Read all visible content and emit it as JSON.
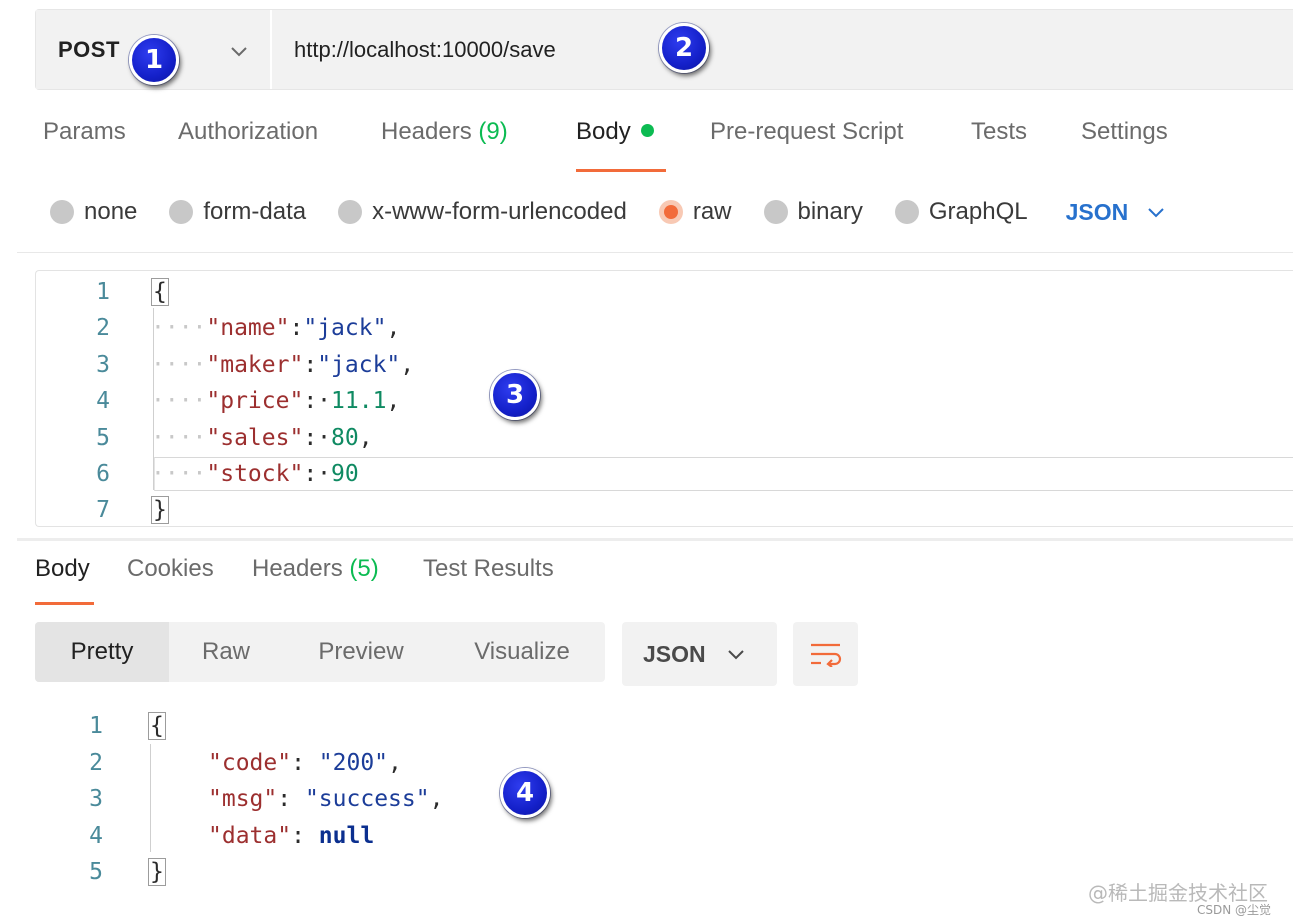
{
  "request": {
    "method": "POST",
    "url": "http://localhost:10000/save"
  },
  "badges": [
    "1",
    "2",
    "3",
    "4"
  ],
  "request_tabs": {
    "params": "Params",
    "authorization": "Authorization",
    "headers": "Headers",
    "headers_count": "(9)",
    "body": "Body",
    "prerequest": "Pre-request Script",
    "tests": "Tests",
    "settings": "Settings"
  },
  "body_types": {
    "none": "none",
    "form_data": "form-data",
    "urlencoded": "x-www-form-urlencoded",
    "raw": "raw",
    "binary": "binary",
    "graphql": "GraphQL",
    "language": "JSON",
    "selected": "raw"
  },
  "request_body": {
    "line_numbers": [
      "1",
      "2",
      "3",
      "4",
      "5",
      "6",
      "7"
    ],
    "open_brace": "{",
    "close_brace": "}",
    "indent": "····",
    "fields": [
      {
        "key": "\"name\"",
        "sep": ":",
        "value": "\"jack\"",
        "type": "str",
        "tail": ","
      },
      {
        "key": "\"maker\"",
        "sep": ":",
        "value": "\"jack\"",
        "type": "str",
        "tail": ","
      },
      {
        "key": "\"price\"",
        "sep": ":·",
        "value": "11.1",
        "type": "num",
        "tail": ","
      },
      {
        "key": "\"sales\"",
        "sep": ":·",
        "value": "80",
        "type": "num",
        "tail": ","
      },
      {
        "key": "\"stock\"",
        "sep": ":·",
        "value": "90",
        "type": "num",
        "tail": ""
      }
    ]
  },
  "response_tabs": {
    "body": "Body",
    "cookies": "Cookies",
    "headers": "Headers",
    "headers_count": "(5)",
    "test_results": "Test Results"
  },
  "response_view": {
    "pretty": "Pretty",
    "raw": "Raw",
    "preview": "Preview",
    "visualize": "Visualize",
    "format": "JSON"
  },
  "response_body": {
    "line_numbers": [
      "1",
      "2",
      "3",
      "4",
      "5"
    ],
    "open_brace": "{",
    "close_brace": "}",
    "fields": [
      {
        "key": "\"code\"",
        "sep": ": ",
        "value": "\"200\"",
        "type": "str",
        "tail": ","
      },
      {
        "key": "\"msg\"",
        "sep": ": ",
        "value": "\"success\"",
        "type": "str",
        "tail": ","
      },
      {
        "key": "\"data\"",
        "sep": ": ",
        "value": "null",
        "type": "kw",
        "tail": ""
      }
    ]
  },
  "watermark": {
    "main": "@稀土掘金技术社区",
    "sub": "CSDN @尘觉"
  },
  "colors": {
    "accent": "#f26b3a",
    "green": "#0cbb52",
    "link_blue": "#2771cd",
    "badge_blue": "#1420c9"
  }
}
